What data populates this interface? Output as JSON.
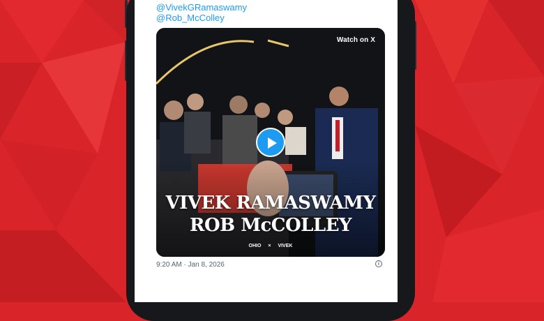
{
  "tweet": {
    "mentions": [
      "@VivekGRamaswamy",
      "@Rob_McColley"
    ],
    "video": {
      "watch_badge": "Watch on X",
      "headline_line1": "VIVEK RAMASWAMY",
      "headline_line2": "ROB McCOLLEY",
      "logo_left": "OHIO",
      "logo_right": "VIVEK",
      "play_icon": "play-icon"
    },
    "timestamp": "9:20 AM · Jan 8, 2026",
    "info_icon": "info-icon"
  },
  "colors": {
    "background_red": "#d9252a",
    "link_blue": "#1d9bf0",
    "meta_gray": "#536471"
  }
}
